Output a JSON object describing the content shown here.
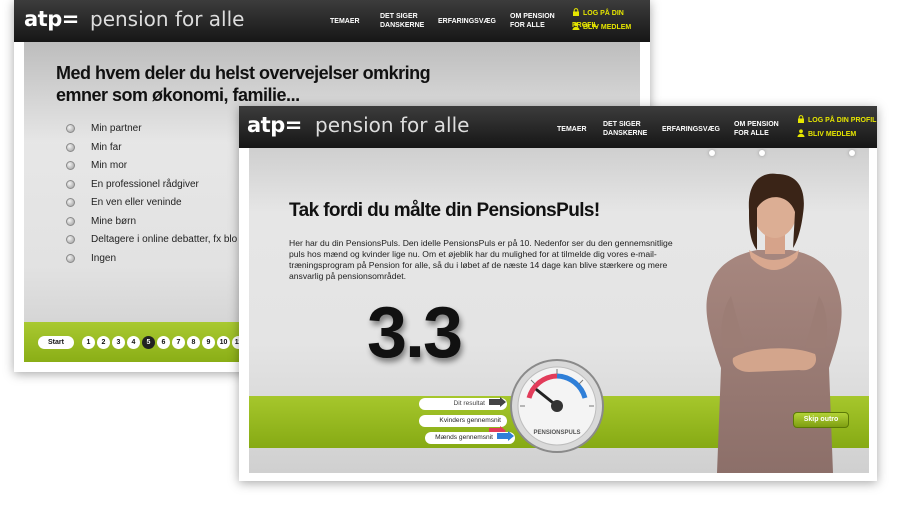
{
  "brand": {
    "logo": "atp=",
    "tagline": "pension for alle"
  },
  "nav": {
    "items": [
      "TEMAER",
      "DET SIGER\nDANSKERNE",
      "ERFARINGSVÆG",
      "OM PENSION\nFOR ALLE"
    ],
    "login": "LOG PÅ DIN PROFIL",
    "member": "BLIV MEDLEM"
  },
  "back_window": {
    "question": "Med hvem deler du helst overvejelser omkring emner som økonomi, familie...",
    "options": [
      "Min partner",
      "Min far",
      "Min mor",
      "En professionel rådgiver",
      "En ven eller veninde",
      "Mine børn",
      "Deltagere i online debatter, fx blo",
      "Ingen"
    ],
    "start_label": "Start",
    "steps": [
      "1",
      "2",
      "3",
      "4",
      "5",
      "6",
      "7",
      "8",
      "9",
      "10",
      "11"
    ],
    "active_step": 5
  },
  "front_window": {
    "heading": "Tak fordi du målte din PensionsPuls!",
    "body": "Her har du din PensionsPuls. Den idelle PensionsPuls er på 10. Nedenfor ser du den gennemsnitlige puls hos mænd og kvinder lige nu. Om et øjeblik har du mulighed for at tilmelde dig vores e-mail-træningsprogram på Pension for alle, så du i løbet af de næste 14 dage kan blive stærkere og mere ansvarlig på pensionsområdet.",
    "score": "3.3",
    "legend": [
      {
        "label": "Dit resultat",
        "color": "#444444"
      },
      {
        "label": "Kvinders gennemsnit",
        "color": "#e23c5a"
      },
      {
        "label": "Mænds gennemsnit",
        "color": "#2f7fd8"
      }
    ],
    "gauge_label": "PENSIONSPULS",
    "skip_label": "Skip outro"
  },
  "colors": {
    "green": "#95b81c",
    "nav_dark": "#1e1e1e",
    "accent_yellow": "#e6e600"
  }
}
